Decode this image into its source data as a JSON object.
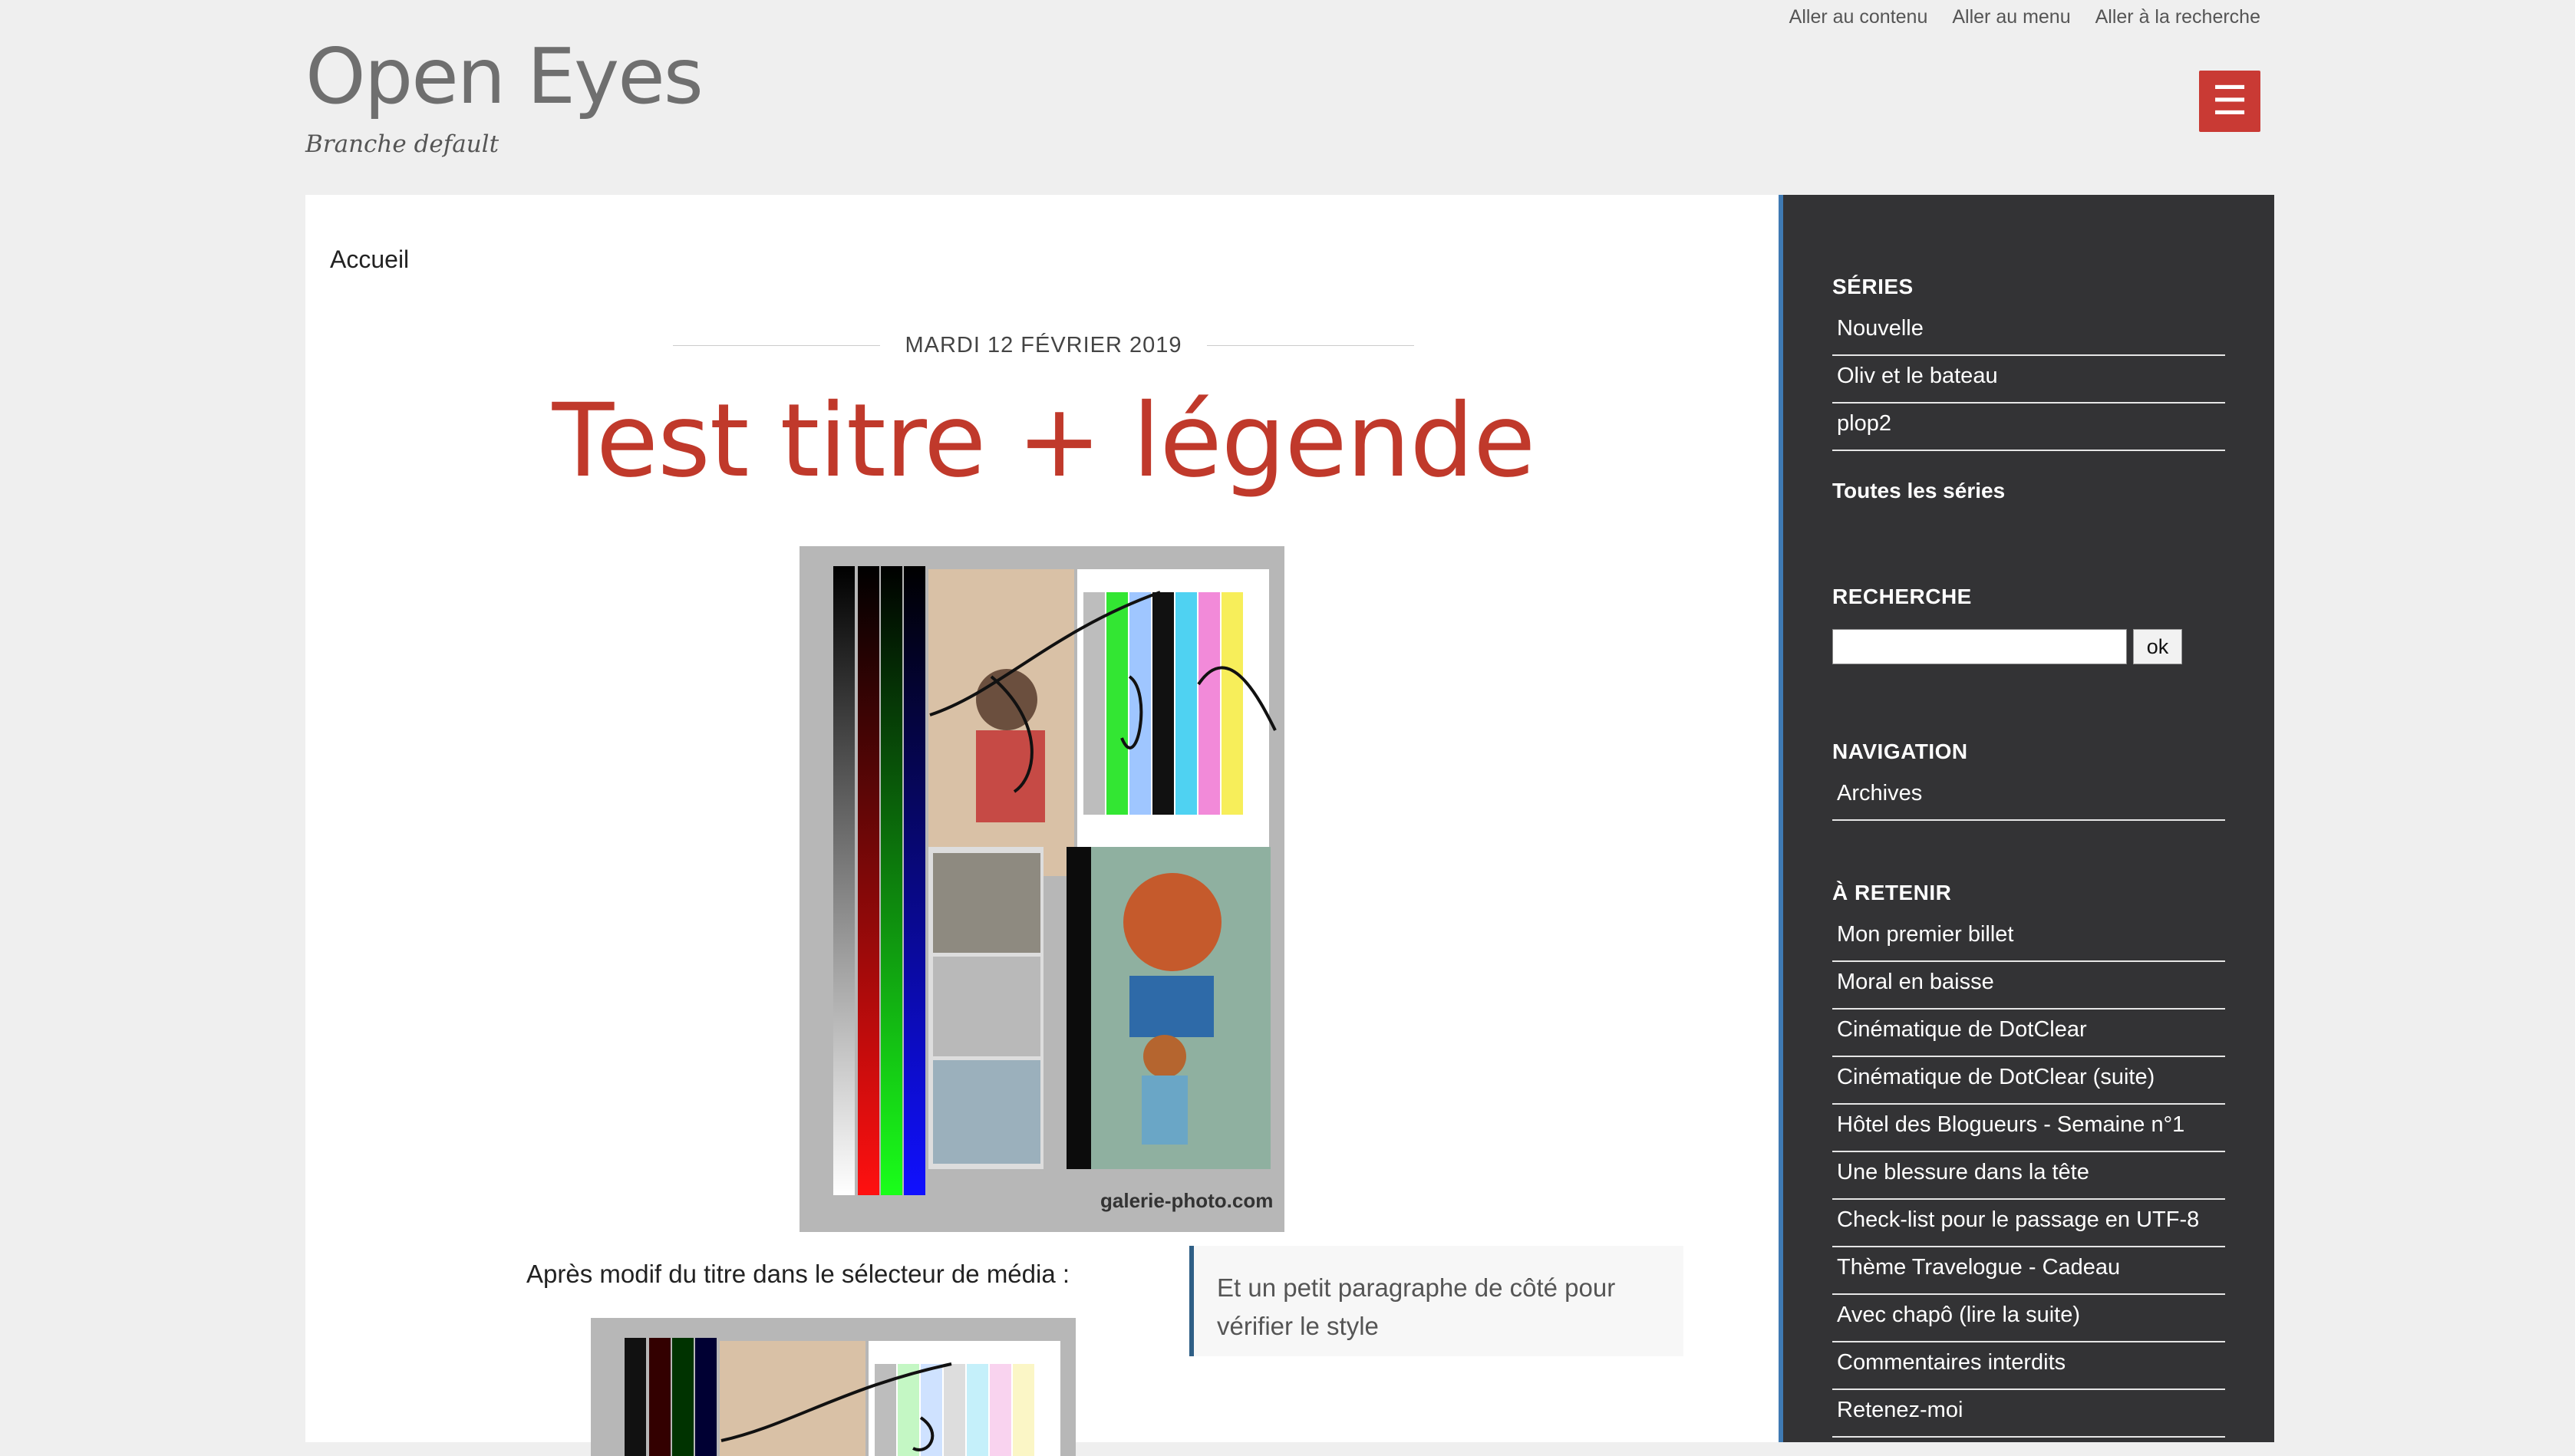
{
  "skip_links": [
    "Aller au contenu",
    "Aller au menu",
    "Aller à la recherche"
  ],
  "site": {
    "title": "Open Eyes",
    "description": "Branche default"
  },
  "menu_button": {
    "icon": "hamburger-icon",
    "symbol": "☰",
    "color": "#c93a34"
  },
  "breadcrumb": "Accueil",
  "post": {
    "date": "MARDI 12 FÉVRIER 2019",
    "title": "Test titre + légende",
    "caption": "Après modif du titre dans le sélecteur de média :",
    "aside": "Et un petit paragraphe de côté pour vérifier le style",
    "image_watermark": "galerie-photo.com",
    "title_color": "#c0392b"
  },
  "sidebar": {
    "series": {
      "heading": "SÉRIES",
      "items": [
        "Nouvelle",
        "Oliv et le bateau",
        "plop2"
      ],
      "all_link": "Toutes les séries"
    },
    "search": {
      "heading": "RECHERCHE",
      "button": "ok",
      "value": ""
    },
    "navigation": {
      "heading": "NAVIGATION",
      "items": [
        "Archives"
      ]
    },
    "retenir": {
      "heading": "À RETENIR",
      "items": [
        "Mon premier billet",
        "Moral en baisse",
        "Cinématique de DotClear",
        "Cinématique de DotClear (suite)",
        "Hôtel des Blogueurs - Semaine n°1",
        "Une blessure dans la tête",
        "Check-list pour le passage en UTF-8",
        "Thème Travelogue - Cadeau",
        "Avec chapô (lire la suite)",
        "Commentaires interdits",
        "Retenez-moi"
      ]
    }
  }
}
